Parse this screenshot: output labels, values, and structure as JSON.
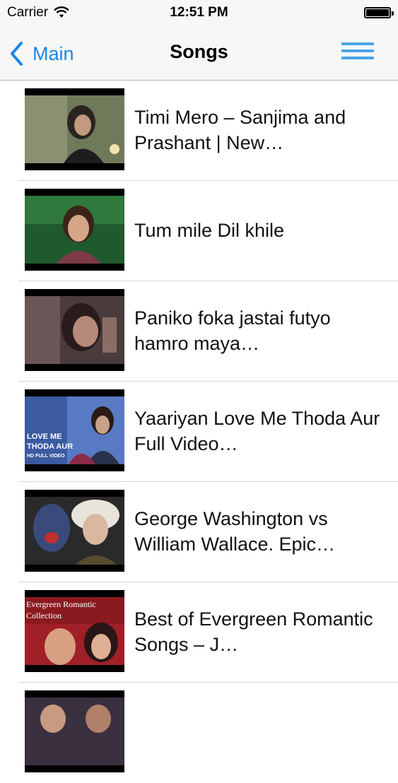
{
  "status_bar": {
    "carrier": "Carrier",
    "time": "12:51 PM"
  },
  "nav": {
    "back_label": "Main",
    "title": "Songs"
  },
  "songs": [
    {
      "title": "Timi Mero – Sanjima and Prashant | New…"
    },
    {
      "title": "Tum mile Dil khile"
    },
    {
      "title": "Paniko foka jastai futyo hamro maya…"
    },
    {
      "title": "Yaariyan Love Me Thoda Aur Full Video…",
      "thumb_text": [
        "LOVE ME",
        "THODA AUR",
        "HD FULL VIDEO"
      ]
    },
    {
      "title": "George Washington vs William Wallace. Epic…"
    },
    {
      "title": "Best of Evergreen Romantic Songs – J…",
      "thumb_text": [
        "Evergreen Romantic",
        "Collection"
      ]
    }
  ],
  "colors": {
    "accent": "#1a86e8",
    "menu": "#4aa3e8",
    "bar_bg": "#f7f7f7",
    "separator": "#d6d6d6"
  }
}
